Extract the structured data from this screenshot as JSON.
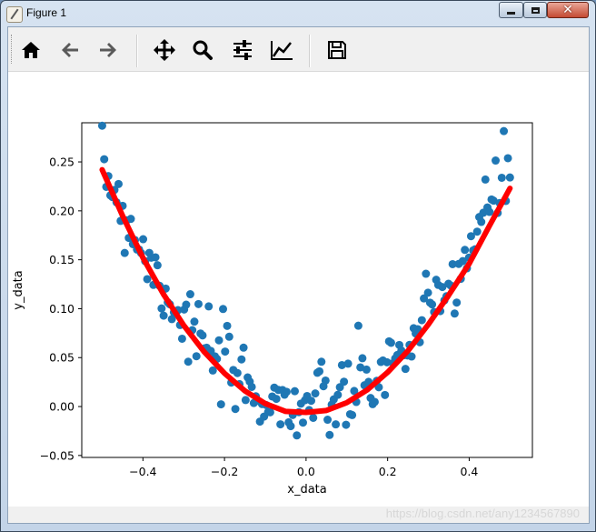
{
  "window": {
    "title": "Figure 1"
  },
  "toolbar": {
    "buttons": [
      {
        "icon": "home-icon"
      },
      {
        "icon": "back-arrow-icon"
      },
      {
        "icon": "forward-arrow-icon"
      },
      {
        "icon": "pan-move-icon"
      },
      {
        "icon": "zoom-magnifier-icon"
      },
      {
        "icon": "subplots-sliders-icon"
      },
      {
        "icon": "edit-axis-line-icon"
      },
      {
        "icon": "save-floppy-icon"
      }
    ]
  },
  "status": {
    "watermark": "https://blog.csdn.net/any1234567890"
  },
  "colors": {
    "scatter": "#1f77b4",
    "fit_line": "#ff0000"
  },
  "chart_data": {
    "type": "scatter",
    "xlabel": "x_data",
    "ylabel": "y_data",
    "xlim": [
      -0.55,
      0.555
    ],
    "ylim": [
      -0.052,
      0.29
    ],
    "xticks": [
      -0.4,
      -0.2,
      0.0,
      0.2,
      0.4
    ],
    "xtick_labels": [
      "−0.4",
      "−0.2",
      "0.0",
      "0.2",
      "0.4"
    ],
    "yticks": [
      -0.05,
      0.0,
      0.05,
      0.1,
      0.15,
      0.2,
      0.25
    ],
    "ytick_labels": [
      "−0.05",
      "0.00",
      "0.05",
      "0.10",
      "0.15",
      "0.20",
      "0.25"
    ],
    "grid": false,
    "series": [
      {
        "type": "scatter",
        "color": "#1f77b4",
        "model": "noisy quadratic, 200 points, x evenly spaced from -0.5 to 0.5",
        "x_range": [
          -0.5,
          0.5
        ],
        "n_points": 200,
        "noise_sd": 0.02
      },
      {
        "type": "line",
        "color": "#ff0000",
        "model": "fitted curve",
        "x": [
          -0.5,
          -0.45,
          -0.4,
          -0.35,
          -0.3,
          -0.25,
          -0.2,
          -0.15,
          -0.1,
          -0.05,
          0.0,
          0.05,
          0.1,
          0.15,
          0.2,
          0.25,
          0.3,
          0.35,
          0.4,
          0.45,
          0.5
        ],
        "y": [
          0.242,
          0.195,
          0.152,
          0.115,
          0.083,
          0.056,
          0.034,
          0.016,
          0.003,
          -0.005,
          -0.006,
          -0.004,
          0.004,
          0.017,
          0.035,
          0.057,
          0.084,
          0.114,
          0.146,
          0.185,
          0.223
        ]
      }
    ]
  }
}
